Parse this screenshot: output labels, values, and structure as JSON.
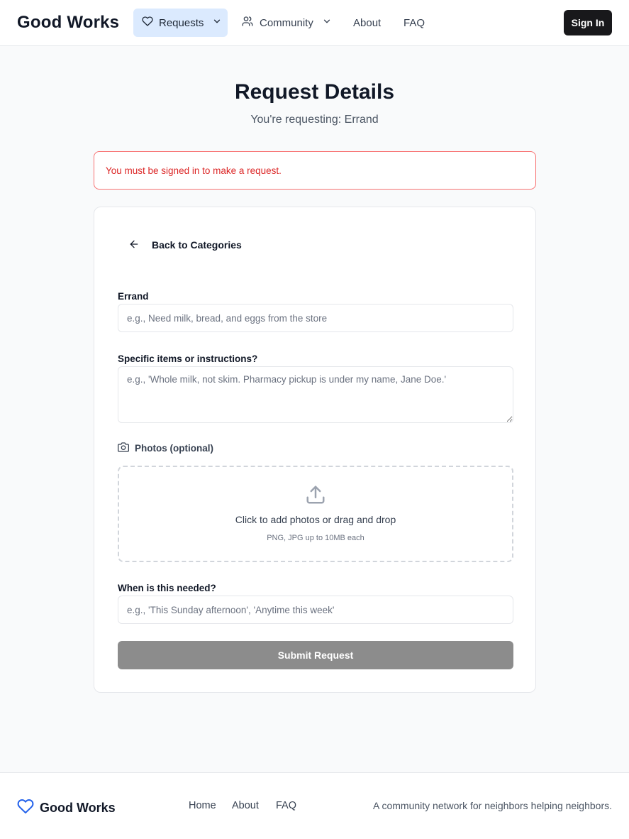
{
  "header": {
    "brand": "Good Works",
    "nav": {
      "requests": "Requests",
      "community": "Community",
      "about": "About",
      "faq": "FAQ"
    },
    "sign_in": "Sign In"
  },
  "page": {
    "title": "Request Details",
    "subtitle": "You're requesting: Errand"
  },
  "alert": {
    "message": "You must be signed in to make a request."
  },
  "form": {
    "back_label": "Back to Categories",
    "errand": {
      "label": "Errand",
      "placeholder": "e.g., Need milk, bread, and eggs from the store",
      "value": ""
    },
    "instructions": {
      "label": "Specific items or instructions?",
      "placeholder": "e.g., 'Whole milk, not skim. Pharmacy pickup is under my name, Jane Doe.'",
      "value": ""
    },
    "photos": {
      "label": "Photos (optional)",
      "dropzone_text": "Click to add photos or drag and drop",
      "dropzone_hint": "PNG, JPG up to 10MB each"
    },
    "when": {
      "label": "When is this needed?",
      "placeholder": "e.g., 'This Sunday afternoon', 'Anytime this week'",
      "value": ""
    },
    "submit_label": "Submit Request"
  },
  "footer": {
    "brand": "Good Works",
    "links": {
      "home": "Home",
      "about": "About",
      "faq": "FAQ"
    },
    "tagline": "A community network for neighbors helping neighbors."
  },
  "colors": {
    "brand_blue": "#2563eb",
    "nav_active_bg": "#dbeafe",
    "alert_red": "#dc2626",
    "button_dark": "#18181b",
    "submit_disabled": "#8c8c8c"
  },
  "icons": {
    "requests": "heart-icon",
    "community": "users-icon",
    "back": "arrow-left-icon",
    "photos": "camera-icon",
    "dropzone": "upload-icon",
    "footer_brand": "heart-icon"
  }
}
